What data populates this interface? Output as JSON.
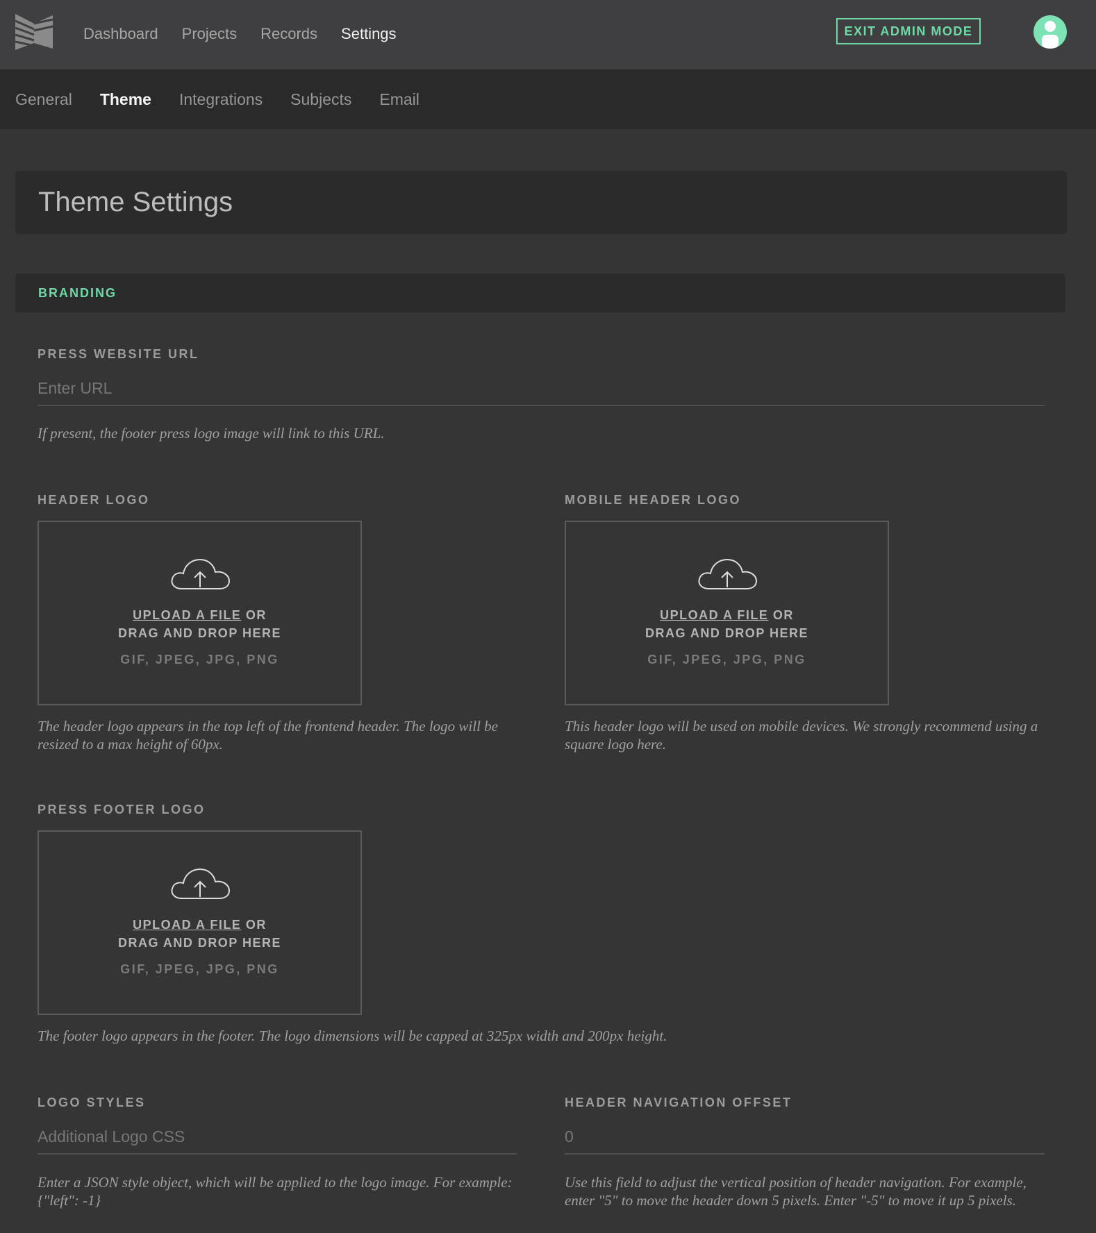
{
  "top_nav": {
    "items": [
      {
        "label": "Dashboard",
        "active": false
      },
      {
        "label": "Projects",
        "active": false
      },
      {
        "label": "Records",
        "active": false
      },
      {
        "label": "Settings",
        "active": true
      }
    ],
    "exit_admin_label": "EXIT ADMIN MODE",
    "logo_icon": "book-logo-icon",
    "avatar_icon": "user-avatar-icon"
  },
  "sub_nav": {
    "items": [
      {
        "label": "General",
        "active": false
      },
      {
        "label": "Theme",
        "active": true
      },
      {
        "label": "Integrations",
        "active": false
      },
      {
        "label": "Subjects",
        "active": false
      },
      {
        "label": "Email",
        "active": false
      }
    ]
  },
  "page": {
    "title": "Theme Settings",
    "section_title": "BRANDING"
  },
  "fields": {
    "press_url": {
      "label": "PRESS WEBSITE URL",
      "placeholder": "Enter URL",
      "value": "",
      "help": "If present, the footer press logo image will link to this URL."
    },
    "header_logo": {
      "label": "HEADER LOGO",
      "help": "The header logo appears in the top left of the frontend header. The logo will be resized to a max height of 60px."
    },
    "mobile_header_logo": {
      "label": "MOBILE HEADER LOGO",
      "help": "This header logo will be used on mobile devices. We strongly recommend using a square logo here."
    },
    "press_footer_logo": {
      "label": "PRESS FOOTER LOGO",
      "help": "The footer logo appears in the footer. The logo dimensions will be capped at 325px width and 200px height."
    },
    "logo_styles": {
      "label": "LOGO STYLES",
      "placeholder": "Additional Logo CSS",
      "value": "",
      "help": "Enter a JSON style object, which will be applied to the logo image. For example: {\"left\": -1}"
    },
    "header_nav_offset": {
      "label": "HEADER NAVIGATION OFFSET",
      "placeholder": "0",
      "value": "",
      "help": "Use this field to adjust the vertical position of header navigation. For example, enter \"5\" to move the header down 5 pixels. Enter \"-5\" to move it up 5 pixels."
    }
  },
  "dropzone": {
    "upload_link": "UPLOAD A FILE",
    "or_text": "OR",
    "drag_text": "DRAG AND DROP HERE",
    "types": "GIF, JPEG, JPG, PNG",
    "icon": "cloud-upload-icon"
  },
  "colors": {
    "accent": "#6fd9a6",
    "background": "#353535",
    "topbar": "#3f3f41",
    "subbar": "#2a2a2a"
  }
}
